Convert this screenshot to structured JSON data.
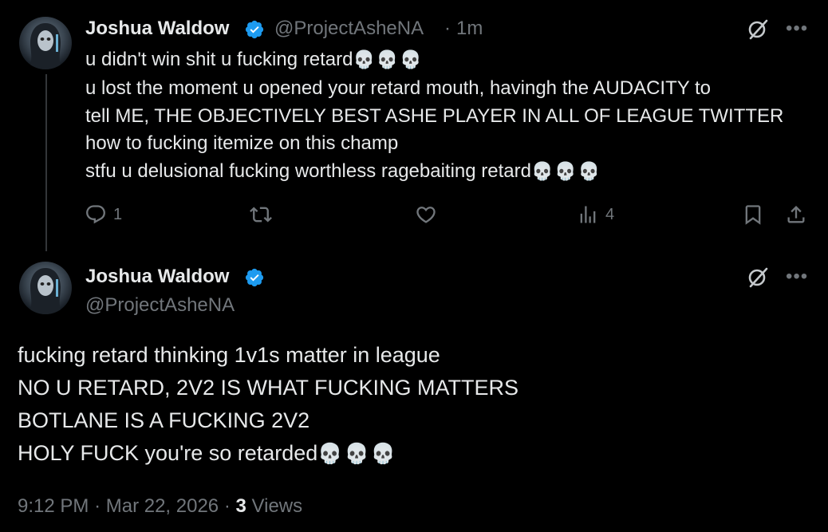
{
  "tweet1": {
    "author_name": "Joshua Waldow",
    "handle": "@ProjectAsheNA",
    "separator": "·",
    "time": "1m",
    "lines": [
      {
        "text": "u didn't win shit u fucking retard",
        "emoji": "💀💀💀"
      },
      {
        "text": "u lost the moment u opened your retard mouth, havingh the AUDACITY to",
        "emoji": ""
      },
      {
        "text": "tell ME, THE OBJECTIVELY BEST ASHE PLAYER IN ALL OF LEAGUE TWITTER",
        "emoji": ""
      },
      {
        "text": "how to fucking itemize on this champ",
        "emoji": ""
      },
      {
        "text": "stfu u delusional fucking worthless ragebaiting retard",
        "emoji": "💀💀💀"
      }
    ],
    "actions": {
      "reply_count": "1",
      "repost_count": "",
      "like_count": "",
      "views_count": "4"
    },
    "icons": [
      "grok-icon",
      "more-icon",
      "reply-icon",
      "repost-icon",
      "like-icon",
      "views-icon",
      "bookmark-icon",
      "share-icon"
    ]
  },
  "tweet2": {
    "author_name": "Joshua Waldow",
    "handle": "@ProjectAsheNA",
    "lines": [
      {
        "text": "fucking retard thinking 1v1s matter in league",
        "emoji": ""
      },
      {
        "text": "NO U RETARD, 2V2 IS WHAT FUCKING MATTERS",
        "emoji": ""
      },
      {
        "text": "BOTLANE IS A FUCKING 2V2",
        "emoji": ""
      },
      {
        "text": "HOLY FUCK you're so retarded",
        "emoji": "💀💀💀"
      }
    ],
    "footer": {
      "time": "9:12 PM",
      "sep1": "·",
      "date": "Mar 22, 2026",
      "sep2": "·",
      "views_count": "3",
      "views_label": "Views"
    }
  },
  "colors": {
    "background": "#000000",
    "text": "#e7e9ea",
    "muted": "#71767b",
    "verified": "#1d9bf0",
    "thread_line": "#333639"
  }
}
